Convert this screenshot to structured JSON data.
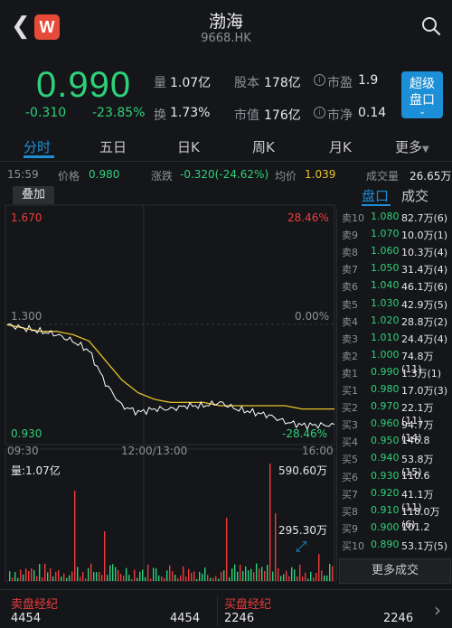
{
  "header": {
    "title": "渤海",
    "code": "9668.HK",
    "logo_letter": "W"
  },
  "quote": {
    "price": "0.990",
    "change": "-0.310",
    "change_pct": "-23.85%",
    "stats": [
      {
        "label": "量",
        "value": "1.07亿"
      },
      {
        "label": "换",
        "value": "1.73%"
      },
      {
        "label": "股本",
        "value": "178亿"
      },
      {
        "label": "市值",
        "value": "176亿"
      },
      {
        "label": "市盈",
        "value": "1.9"
      },
      {
        "label": "市净",
        "value": "0.14"
      }
    ],
    "super_button": [
      "超级",
      "盘口"
    ]
  },
  "tabs": [
    "分时",
    "五日",
    "日K",
    "周K",
    "月K",
    "更多"
  ],
  "info_row": {
    "time": "15:59",
    "price_label": "价格",
    "price_value": "0.980",
    "change_label": "涨跌",
    "change_value": "-0.320(-24.62%)",
    "avg_label": "均价",
    "avg_value": "1.039",
    "volume_label": "成交量",
    "volume_value": "26.65万"
  },
  "chart": {
    "overlay_button": "叠加",
    "y_top": "1.670",
    "y_mid": "1.300",
    "y_bottom": "0.930",
    "pct_top": "28.46%",
    "pct_mid": "0.00%",
    "pct_bottom": "-28.46%",
    "time_start": "09:30",
    "time_mid": "12:00/13:00",
    "time_end": "16:00",
    "volume_label": "量:1.07亿",
    "vol_max": "590.60万",
    "vol_mid": "295.30万",
    "colors": {
      "price_line": "#ffffff",
      "avg_line": "#e6c229",
      "up": "#f03c3c",
      "down": "#2fd07a"
    }
  },
  "chart_data": {
    "type": "line",
    "x_range": [
      "09:30",
      "16:00"
    ],
    "ylim": [
      0.93,
      1.67
    ],
    "pct_range": [
      "-28.46%",
      "28.46%"
    ],
    "series": [
      {
        "values": [
          1.3,
          1.29,
          1.28,
          1.27,
          1.25,
          1.22,
          1.12,
          1.05,
          1.03,
          1.04,
          1.04,
          1.05,
          1.05,
          1.06,
          1.04,
          1.03,
          1.02,
          1.0,
          0.99,
          0.99,
          0.99
        ]
      },
      {
        "values": [
          1.3,
          1.29,
          1.28,
          1.28,
          1.27,
          1.25,
          1.19,
          1.13,
          1.09,
          1.07,
          1.06,
          1.06,
          1.06,
          1.05,
          1.05,
          1.05,
          1.05,
          1.05,
          1.04,
          1.04,
          1.04
        ]
      }
    ]
  },
  "right_panel": {
    "tabs": [
      "盘口",
      "成交"
    ],
    "order_book": [
      {
        "label": "卖10",
        "price": "1.080",
        "vol": "82.7万(6)"
      },
      {
        "label": "卖9",
        "price": "1.070",
        "vol": "10.0万(1)"
      },
      {
        "label": "卖8",
        "price": "1.060",
        "vol": "10.3万(4)"
      },
      {
        "label": "卖7",
        "price": "1.050",
        "vol": "31.4万(4)"
      },
      {
        "label": "卖6",
        "price": "1.040",
        "vol": "46.1万(6)"
      },
      {
        "label": "卖5",
        "price": "1.030",
        "vol": "42.9万(5)"
      },
      {
        "label": "卖4",
        "price": "1.020",
        "vol": "28.8万(2)"
      },
      {
        "label": "卖3",
        "price": "1.010",
        "vol": "24.4万(4)"
      },
      {
        "label": "卖2",
        "price": "1.000",
        "vol": "74.8万(11)"
      },
      {
        "label": "卖1",
        "price": "0.990",
        "vol": "1.3万(1)"
      },
      {
        "label": "买1",
        "price": "0.980",
        "vol": "17.0万(3)"
      },
      {
        "label": "买2",
        "price": "0.970",
        "vol": "22.1万(11)"
      },
      {
        "label": "买3",
        "price": "0.960",
        "vol": "94.7万(14)"
      },
      {
        "label": "买4",
        "price": "0.950",
        "vol": "146.8"
      },
      {
        "label": "买5",
        "price": "0.940",
        "vol": "53.8万(15)"
      },
      {
        "label": "买6",
        "price": "0.930",
        "vol": "110.6"
      },
      {
        "label": "买7",
        "price": "0.920",
        "vol": "41.1万(11)"
      },
      {
        "label": "买8",
        "price": "0.910",
        "vol": "118.0万(6)"
      },
      {
        "label": "买9",
        "price": "0.900",
        "vol": "101.2"
      },
      {
        "label": "买10",
        "price": "0.890",
        "vol": "53.1万(5)"
      }
    ],
    "more_deals": "更多成交"
  },
  "broker": {
    "sell_label": "卖盘经纪",
    "sell_left": "4454",
    "sell_right": "4454",
    "buy_label": "买盘经纪",
    "buy_left": "2246",
    "buy_right": "2246"
  }
}
